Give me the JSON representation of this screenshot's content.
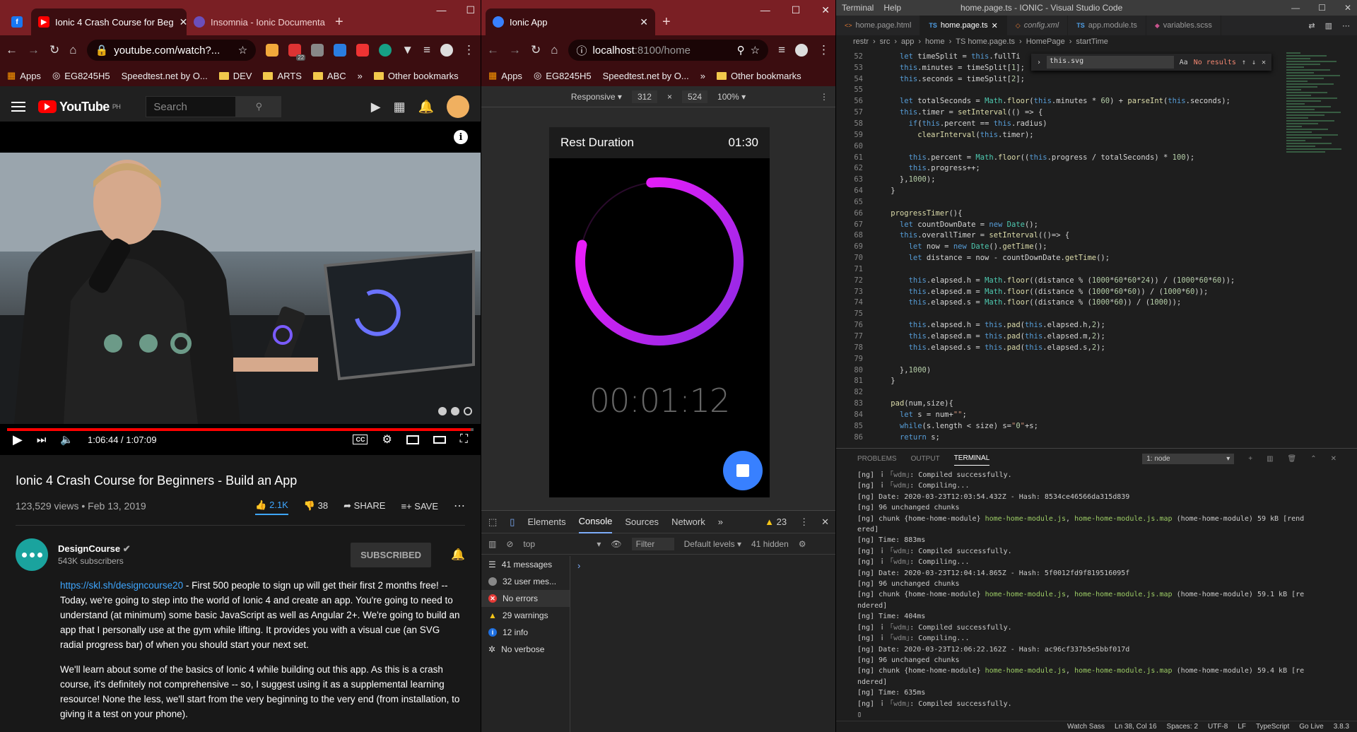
{
  "left_browser": {
    "tabs": [
      {
        "title": "Ionic 4 Crash Course for Beg",
        "active": true
      },
      {
        "title": "Insomnia - Ionic Documenta",
        "active": false
      }
    ],
    "url": "youtube.com/watch?...",
    "ext_badge": "22",
    "bookmarks": [
      "Apps",
      "EG8245H5",
      "Speedtest.net by O...",
      "DEV",
      "ARTS",
      "ABC"
    ],
    "other_bookmarks": "Other bookmarks",
    "more": "»"
  },
  "youtube": {
    "logo": "YouTube",
    "region": "PH",
    "search_placeholder": "Search",
    "time": "1:06:44 / 1:07:09",
    "progress": 0.994,
    "title": "Ionic 4 Crash Course for Beginners - Build an App",
    "views": "123,529 views • Feb 13, 2019",
    "likes": "2.1K",
    "dislikes": "38",
    "share": "SHARE",
    "save": "SAVE",
    "channel": "DesignCourse",
    "subscribers": "543K subscribers",
    "subscribed": "SUBSCRIBED",
    "desc_link": "https://skl.sh/designcourse20",
    "desc1": " - First 500 people to sign up will get their first 2 months free! -- Today, we're going to step into the world of Ionic 4 and create an app. You're going to need to understand (at minimum) some basic JavaScript as well as Angular 2+. We're going to build an app that I personally use at the gym while lifting. It provides you with a visual cue (an SVG radial progress bar) of when you should start your next set.",
    "desc2": "We'll learn about some of the basics of Ionic 4 while building out this app. As this is a crash course, it's definitely not comprehensive -- so, I suggest using it as a supplemental learning resource! None the less, we'll start from the very beginning to the very end (from installation, to giving it a test on your phone)."
  },
  "mid_browser": {
    "tab": "Ionic App",
    "url_host": "localhost",
    "url_path": ":8100/home",
    "bookmarks": [
      "Apps",
      "EG8245H5",
      "Speedtest.net by O..."
    ],
    "other_bookmarks": "Other bookmarks",
    "device": "Responsive",
    "width": "312",
    "height": "524",
    "zoom": "100%"
  },
  "ionic_app": {
    "title": "Rest Duration",
    "duration": "01:30",
    "elapsed": "00:01:12",
    "progress": 0.8
  },
  "devtools": {
    "tabs": [
      "Elements",
      "Console",
      "Sources",
      "Network"
    ],
    "active": "Console",
    "warn_count": "23",
    "context": "top",
    "filter": "Filter",
    "levels": "Default levels",
    "hidden": "41 hidden",
    "sidebar": [
      "41 messages",
      "32 user mes...",
      "No errors",
      "29 warnings",
      "12 info",
      "No verbose"
    ]
  },
  "vscode": {
    "menu": [
      "Terminal",
      "Help"
    ],
    "title": "home.page.ts - IONIC - Visual Studio Code",
    "tabs": [
      "home.page.html",
      "home.page.ts",
      "config.xml",
      "app.module.ts",
      "variables.scss"
    ],
    "breadcrumb": [
      "restr",
      "src",
      "app",
      "home",
      "TS home.page.ts",
      "HomePage",
      "startTime"
    ],
    "find": "this.svg",
    "find_result": "No results",
    "code_start": 52,
    "code": [
      "      let timeSplit = this.fullTi",
      "      this.minutes = timeSplit[1];",
      "      this.seconds = timeSplit[2];",
      "",
      "      let totalSeconds = Math.floor(this.minutes * 60) + parseInt(this.seconds);",
      "      this.timer = setInterval(() => {",
      "        if(this.percent == this.radius)",
      "          clearInterval(this.timer);",
      "",
      "        this.percent = Math.floor((this.progress / totalSeconds) * 100);",
      "        this.progress++;",
      "      },1000);",
      "    }",
      "",
      "    progressTimer(){",
      "      let countDownDate = new Date();",
      "      this.overallTimer = setInterval(()=> {",
      "        let now = new Date().getTime();",
      "        let distance = now - countDownDate.getTime();",
      "",
      "        this.elapsed.h = Math.floor((distance % (1000*60*60*24)) / (1000*60*60));",
      "        this.elapsed.m = Math.floor((distance % (1000*60*60)) / (1000*60));",
      "        this.elapsed.s = Math.floor((distance % (1000*60)) / (1000));",
      "",
      "        this.elapsed.h = this.pad(this.elapsed.h,2);",
      "        this.elapsed.m = this.pad(this.elapsed.m,2);",
      "        this.elapsed.s = this.pad(this.elapsed.s,2);",
      "",
      "      },1000)",
      "    }",
      "",
      "    pad(num,size){",
      "      let s = num+\"\";",
      "      while(s.length < size) s=\"0\"+s;",
      "      return s;"
    ],
    "panel_tabs": [
      "PROBLEMS",
      "OUTPUT",
      "TERMINAL"
    ],
    "terminal_select": "1: node",
    "terminal": [
      "[ng] ｉ ｢wdm｣: Compiled successfully.",
      "[ng] ｉ ｢wdm｣: Compiling...",
      "[ng] Date: 2020-03-23T12:03:54.432Z - Hash: 8534ce46566da315d839",
      "[ng] 96 unchanged chunks",
      "[ng] chunk {home-home-module} home-home-module.js, home-home-module.js.map (home-home-module) 59 kB  [rend",
      "ered]",
      "[ng] Time: 883ms",
      "[ng] ｉ ｢wdm｣: Compiled successfully.",
      "[ng] ｉ ｢wdm｣: Compiling...",
      "[ng] Date: 2020-03-23T12:04:14.865Z - Hash: 5f0012fd9f819516095f",
      "[ng] 96 unchanged chunks",
      "[ng] chunk {home-home-module} home-home-module.js, home-home-module.js.map (home-home-module) 59.1 kB  [re",
      "ndered]",
      "[ng] Time: 404ms",
      "[ng] ｉ ｢wdm｣: Compiled successfully.",
      "[ng] ｉ ｢wdm｣: Compiling...",
      "[ng] Date: 2020-03-23T12:06:22.162Z - Hash: ac96cf337b5e5bbf017d",
      "[ng] 96 unchanged chunks",
      "[ng] chunk {home-home-module} home-home-module.js, home-home-module.js.map (home-home-module) 59.4 kB  [re",
      "ndered]",
      "[ng] Time: 635ms",
      "[ng] ｉ ｢wdm｣: Compiled successfully."
    ],
    "status": [
      "Watch Sass",
      "Ln 38, Col 16",
      "Spaces: 2",
      "UTF-8",
      "LF",
      "TypeScript",
      "Go Live",
      "3.8.3"
    ]
  },
  "colors": {
    "accent_red": "#7a1f24",
    "progress_start": "#8a2be2",
    "progress_end": "#ff1aff",
    "fab": "#3880ff"
  }
}
